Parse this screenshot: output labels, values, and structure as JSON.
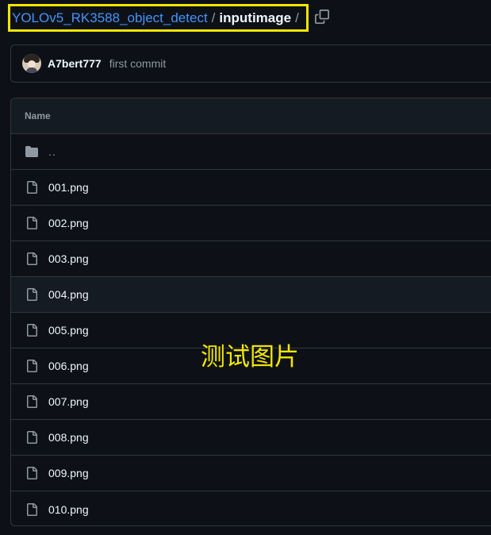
{
  "breadcrumb": {
    "repo": "YOLOv5_RK3588_object_detect",
    "separator": "/",
    "current_dir": "inputimage",
    "trailing_separator": "/",
    "copy_icon": "copy-icon",
    "highlight_color": "#f3e600"
  },
  "commit": {
    "author": "A7bert777",
    "message": "first commit"
  },
  "table": {
    "header": "Name",
    "parent_label": "..",
    "folder_icon": "folder-icon",
    "file_icon": "file-icon",
    "files": [
      "001.png",
      "002.png",
      "003.png",
      "004.png",
      "005.png",
      "006.png",
      "007.png",
      "008.png",
      "009.png",
      "010.png"
    ]
  },
  "overlay": {
    "text": "测试图片",
    "color": "#f3e600"
  },
  "colors": {
    "background": "#0d1117",
    "border": "#30363d",
    "link": "#4493f8",
    "muted": "#9198a1"
  }
}
